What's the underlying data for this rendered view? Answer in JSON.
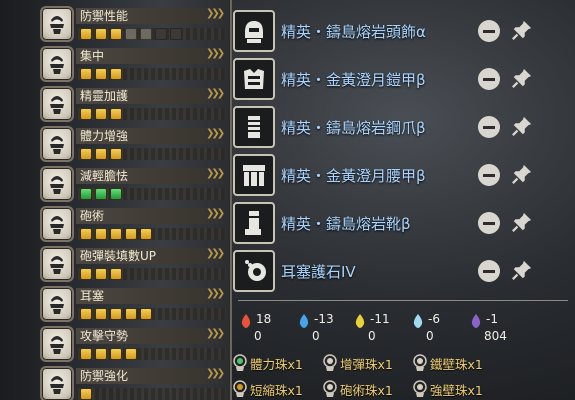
{
  "skills": [
    {
      "name": "防禦性能",
      "pips": [
        "gold",
        "gold",
        "gold",
        "off",
        "off",
        "dark",
        "dark"
      ]
    },
    {
      "name": "集中",
      "pips": [
        "gold",
        "gold",
        "gold"
      ]
    },
    {
      "name": "精靈加護",
      "pips": [
        "gold",
        "gold",
        "gold"
      ]
    },
    {
      "name": "體力增強",
      "pips": [
        "gold",
        "gold",
        "gold"
      ]
    },
    {
      "name": "減輕膽怯",
      "pips": [
        "green",
        "green",
        "green"
      ]
    },
    {
      "name": "砲術",
      "pips": [
        "gold",
        "gold",
        "gold",
        "gold",
        "gold"
      ]
    },
    {
      "name": "砲彈裝填數UP",
      "pips": [
        "gold",
        "gold",
        "gold"
      ]
    },
    {
      "name": "耳塞",
      "pips": [
        "gold",
        "gold",
        "gold",
        "gold",
        "gold"
      ]
    },
    {
      "name": "攻擊守勢",
      "pips": [
        "gold",
        "gold",
        "gold",
        "gold"
      ]
    },
    {
      "name": "防禦強化",
      "pips": [
        "gold"
      ]
    }
  ],
  "equipment": [
    {
      "name": "精英・鑄島熔岩頭飾α",
      "icon": "helmet-icon"
    },
    {
      "name": "精英・金黃澄月鎧甲β",
      "icon": "chest-armor-icon"
    },
    {
      "name": "精英・鑄島熔岩鋼爪β",
      "icon": "gauntlet-icon"
    },
    {
      "name": "精英・金黃澄月腰甲β",
      "icon": "waist-armor-icon"
    },
    {
      "name": "精英・鑄島熔岩靴β",
      "icon": "boots-icon"
    },
    {
      "name": "耳塞護石IV",
      "icon": "charm-icon"
    }
  ],
  "stats": [
    {
      "icon": "fire-res-icon",
      "color": "#e8533a",
      "top": "18",
      "bottom": "0"
    },
    {
      "icon": "water-res-icon",
      "color": "#4aa3e8",
      "top": "-13",
      "bottom": "0"
    },
    {
      "icon": "thunder-res-icon",
      "color": "#e8d03a",
      "top": "-11",
      "bottom": "0"
    },
    {
      "icon": "ice-res-icon",
      "color": "#9fdcf2",
      "top": "-6",
      "bottom": "0"
    },
    {
      "icon": "dragon-res-icon",
      "color": "#8a64c9",
      "top": "-1",
      "bottom": "804"
    }
  ],
  "decorations": [
    {
      "name": "體力珠x1",
      "color": "#4fc46a"
    },
    {
      "name": "增彈珠x1",
      "color": "#d7d2c4"
    },
    {
      "name": "鐵壁珠x1",
      "color": "#d7d2c4"
    },
    {
      "name": "短縮珠x1",
      "color": "#d49a1a"
    },
    {
      "name": "砲術珠x1",
      "color": "#d7d2c4"
    },
    {
      "name": "強壁珠x1",
      "color": "#d7d2c4"
    }
  ]
}
